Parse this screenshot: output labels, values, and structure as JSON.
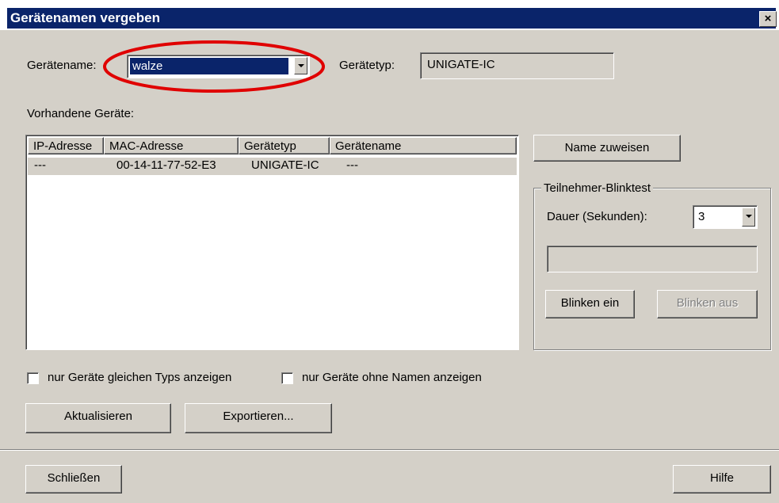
{
  "window": {
    "title": "Gerätenamen vergeben",
    "close_symbol": "×"
  },
  "device_name": {
    "label": "Gerätename:",
    "value": "walze"
  },
  "device_type": {
    "label": "Gerätetyp:",
    "value": "UNIGATE-IC"
  },
  "devices": {
    "label": "Vorhandene Geräte:",
    "columns": [
      "IP-Adresse",
      "MAC-Adresse",
      "Gerätetyp",
      "Gerätename"
    ],
    "rows": [
      [
        "---",
        "00-14-11-77-52-E3",
        "UNIGATE-IC",
        "---"
      ]
    ]
  },
  "assign_button": "Name zuweisen",
  "blink_test": {
    "legend": "Teilnehmer-Blinktest",
    "duration_label": "Dauer (Sekunden):",
    "duration_value": "3",
    "status_text": "",
    "on_button": "Blinken ein",
    "off_button": "Blinken aus"
  },
  "filters": {
    "same_type": "nur Geräte gleichen Typs anzeigen",
    "without_name": "nur Geräte ohne Namen anzeigen"
  },
  "refresh_button": "Aktualisieren",
  "export_button": "Exportieren...",
  "close_button": "Schließen",
  "help_button": "Hilfe",
  "annotation_color": "#e00000"
}
